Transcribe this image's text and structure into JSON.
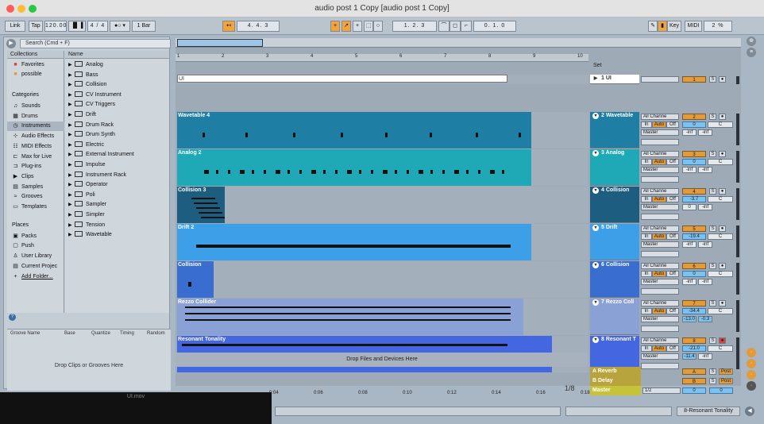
{
  "window": {
    "title": "audio post 1 Copy  [audio post 1 Copy]"
  },
  "control": {
    "link": "Link",
    "tap": "Tap",
    "bpm": "120.00",
    "sig": "4 / 4",
    "quant": "1 Bar",
    "pos": "4.  4.  3",
    "loop_start": "1.  2.  3",
    "loop_len": "0.  1.  0",
    "key": "Key",
    "midi": "MIDI",
    "cpu": "2 %"
  },
  "browser": {
    "search_placeholder": "Search (Cmd + F)",
    "collections_header": "Collections",
    "name_header": "Name",
    "collections": [
      {
        "label": "Favorites",
        "icon": "■"
      },
      {
        "label": "possible",
        "icon": "■"
      }
    ],
    "categories_header": "Categories",
    "categories": [
      {
        "label": "Sounds",
        "icon": "♫"
      },
      {
        "label": "Drums",
        "icon": "▦"
      },
      {
        "label": "Instruments",
        "icon": "◷"
      },
      {
        "label": "Audio Effects",
        "icon": "⊹"
      },
      {
        "label": "MIDI Effects",
        "icon": "☷"
      },
      {
        "label": "Max for Live",
        "icon": "⊏"
      },
      {
        "label": "Plug-ins",
        "icon": "⊐"
      },
      {
        "label": "Clips",
        "icon": "▶"
      },
      {
        "label": "Samples",
        "icon": "▤"
      },
      {
        "label": "Grooves",
        "icon": "≈"
      },
      {
        "label": "Templates",
        "icon": "▭"
      }
    ],
    "places_header": "Places",
    "places": [
      {
        "label": "Packs",
        "icon": "▣"
      },
      {
        "label": "Push",
        "icon": "▢"
      },
      {
        "label": "User Library",
        "icon": "♙"
      },
      {
        "label": "Current Projec",
        "icon": "▤"
      },
      {
        "label": "Add Folder...",
        "icon": "+"
      }
    ],
    "items": [
      "Analog",
      "Bass",
      "Collision",
      "CV Instrument",
      "CV Triggers",
      "Drift",
      "Drum Rack",
      "Drum Synth",
      "Electric",
      "External Instrument",
      "Impulse",
      "Instrument Rack",
      "Operator",
      "Poli",
      "Sampler",
      "Simpler",
      "Tension",
      "Wavetable"
    ],
    "groove_headers": [
      "Groove Name",
      "Base",
      "Quantize",
      "Timing",
      "Random"
    ],
    "groove_drop": "Drop Clips or Grooves Here"
  },
  "arrangement": {
    "ruler": [
      "1",
      "2",
      "3",
      "4",
      "5",
      "6",
      "7",
      "8",
      "9",
      "10"
    ],
    "set_label": "Set",
    "tracks": [
      {
        "clip": "UI",
        "name": "1 UI",
        "num": "1",
        "vol": "",
        "pan": "",
        "color": "#ffffff"
      },
      {
        "clip": "Wavetable 4",
        "name": "2 Wavetable",
        "num": "2",
        "vol": "0",
        "pan": "C",
        "inL": "-inf",
        "inR": "-inf",
        "color": "#1f7ea3"
      },
      {
        "clip": "Analog 2",
        "name": "3 Analog",
        "num": "3",
        "vol": "0",
        "pan": "C",
        "inL": "-inf",
        "inR": "-inf",
        "color": "#1fa8b6"
      },
      {
        "clip": "Collision 3",
        "name": "4 Collision",
        "num": "4",
        "vol": "-3.7",
        "pan": "C",
        "inL": "0",
        "inR": "-inf",
        "color": "#1d5d80"
      },
      {
        "clip": "Drift 2",
        "name": "5 Drift",
        "num": "5",
        "vol": "-19.4",
        "pan": "C",
        "inL": "-inf",
        "inR": "-inf",
        "color": "#3d9fe8"
      },
      {
        "clip": "Collision",
        "name": "6 Collision",
        "num": "6",
        "vol": "0",
        "pan": "C",
        "inL": "-inf",
        "inR": "-inf",
        "color": "#3a6dd0"
      },
      {
        "clip": "Rezzo Collider",
        "name": "7 Rezzo Coll",
        "num": "7",
        "vol": "-34.4",
        "pan": "C",
        "inL": "-13.0",
        "inR": "-0.3",
        "color": "#8aa1d6"
      },
      {
        "clip": "Resonant Tonality",
        "name": "8 Resonant T",
        "num": "8",
        "vol": "-21.0",
        "pan": "C",
        "inL": "-11.4",
        "inR": "-inf",
        "color": "#4466e0"
      }
    ],
    "io": {
      "all": "All Channe",
      "in": "In",
      "auto": "Auto",
      "off": "Off",
      "master": "Master"
    },
    "drop": "Drop Files and Devices Here",
    "returns": [
      {
        "name": "A Reverb",
        "num": "A",
        "post": "Post"
      },
      {
        "name": "B Delay",
        "num": "B",
        "post": "Post"
      }
    ],
    "master": {
      "name": "Master",
      "quant": "1/2",
      "vol": "0",
      "pan": "0"
    },
    "time_ruler": [
      "0:04",
      "0:06",
      "0:08",
      "0:10",
      "0:12",
      "0:14",
      "0:16",
      "0:18"
    ],
    "page": "1/8"
  },
  "clipwin": {
    "title": "UI.mov"
  },
  "status": {
    "selected_track": "8-Resonant Tonality"
  }
}
